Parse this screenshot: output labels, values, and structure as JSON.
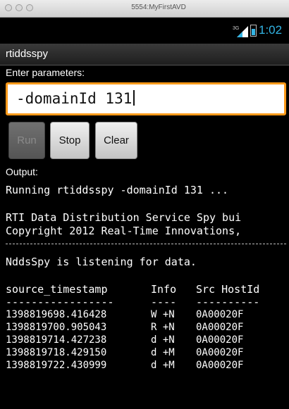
{
  "window": {
    "title": "5554:MyFirstAVD"
  },
  "status_bar": {
    "network": "3G",
    "time": "1:02",
    "accent": "#33b5e5"
  },
  "app": {
    "title": "rtiddsspy"
  },
  "parameters": {
    "label": "Enter parameters:",
    "value": "-domainId 131"
  },
  "buttons": {
    "run": "Run",
    "stop": "Stop",
    "clear": "Clear"
  },
  "output": {
    "label": "Output:",
    "running": "Running rtiddsspy -domainId 131 ...",
    "banner1": "RTI Data Distribution Service Spy bui",
    "banner2": "Copyright 2012 Real-Time Innovations,",
    "listening": "NddsSpy is listening for data.",
    "columns": {
      "timestamp": "source_timestamp",
      "info": "Info",
      "host": "Src HostId"
    },
    "separators": {
      "timestamp": "-----------------",
      "info": "----",
      "host": "----------"
    },
    "rows": [
      {
        "timestamp": "1398819698.416428",
        "info": "W +N",
        "host": "0A00020F"
      },
      {
        "timestamp": "1398819700.905043",
        "info": "R +N",
        "host": "0A00020F"
      },
      {
        "timestamp": "1398819714.427238",
        "info": "d +N",
        "host": "0A00020F"
      },
      {
        "timestamp": "1398819718.429150",
        "info": "d +M",
        "host": "0A00020F"
      },
      {
        "timestamp": "1398819722.430999",
        "info": "d +M",
        "host": "0A00020F"
      }
    ]
  },
  "colors": {
    "focus_border": "#ff9a1a",
    "background": "#000000"
  }
}
